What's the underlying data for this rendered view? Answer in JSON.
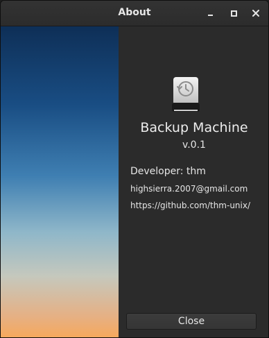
{
  "window": {
    "title": "About",
    "controls": [
      "minimize-icon",
      "maximize-icon",
      "close-icon"
    ]
  },
  "sidebar": {
    "gradient_top": "#0e2f57",
    "gradient_bottom": "#f7a85a"
  },
  "about": {
    "icon": "backup-drive-icon",
    "app_name": "Backup Machine",
    "version": "v.0.1",
    "developer": "Developer: thm",
    "email": "highsierra.2007@gmail.com",
    "url": "https://github.com/thm-unix/",
    "close_label": "Close"
  },
  "colors": {
    "background": "#2b2b2b",
    "text": "#e6e6e6"
  }
}
